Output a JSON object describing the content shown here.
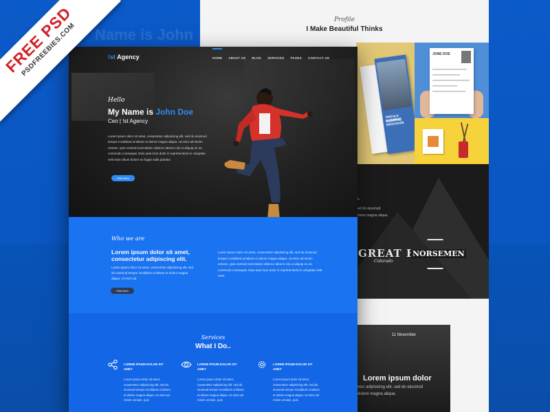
{
  "badge": {
    "main": "FREE PSD",
    "sub": "PSDFREEBIES.COM"
  },
  "background_ghost": "Name is John",
  "back_page": {
    "profile_script": "Profile",
    "profile_title": "I Make Beautiful Thinks",
    "brochure_line1": "TRIFOLD BUSINESS",
    "brochure_line2": "CREATIVE BROCHURE",
    "resume_name": "JONE DOE",
    "dark_text_a": "o..",
    "dark_text_b": "sed do eiusmod",
    "dark_text_c": "dolore magna aliqua.",
    "logo_great": "GREAT  FALLS",
    "logo_colorado": "Colorado",
    "logo_norsemen": "NORSEMEN",
    "news_date": "11 November",
    "news_title": "Lorem ipsum dolor",
    "news_text1": "etur adipisicing elit, sed do eiusmod",
    "news_text2": "dolore magna aliqua."
  },
  "front_page": {
    "brand_prefix": "!st",
    "brand_suffix": " Agency",
    "nav": [
      "HOME",
      "ABOUT US",
      "BLOG",
      "SERVICES",
      "PAGES",
      "CONTACT US"
    ],
    "hero": {
      "hello": "Hello",
      "title_prefix": "My Name is ",
      "title_name": "John Doe",
      "subtitle": "Ceo |  !st Agency",
      "paragraph": "Lorem ipsum dolor sit amet, consectetur adipisicing elit, sed do eiusmod tempor incididunt ut labore et dolore magna aliqua. Ut enim ad minim veniam, quis nostrud exercitation ullamco laboris nisi ut aliquip ex ea commodo consequat. Duis aute irure dolor in reprehenderit in voluptate velit esse cillum dolore eu fugiat nulla pariatur.",
      "button": "Click here"
    },
    "who": {
      "script": "Who we are",
      "heading_line1": "Lorem ipsum dolor sit amet,",
      "heading_line2": "consectetur adipiscing elit.",
      "left_paragraph": "Lorem ipsum dolor sit amet, consectetur adipisicing elit, sed do eiusmod tempor incididunt ut labore et dolore magna aliqua. Ut enim ad",
      "right_paragraph": "Lorem ipsum dolor sit amet, consectetur adipisicing elit, sed do eiusmod tempor incididunt ut labore et dolore magna aliqua. Ut enim ad minim veniam, quis nostrud exercitation ullamco laboris nisi ut aliquip ex ea commodo consequat. Duis aute irure dolor in reprehenderit in voluptate velit esse",
      "button": "Click here"
    },
    "services": {
      "script": "Services",
      "title": "What I Do..",
      "items": [
        {
          "icon": "share-icon",
          "head": "LOREM IPSUM DOLOR SIT AMET",
          "text": "Lorem ipsum dolor sit amet, consectetur adipisicing elit, sed do eiusmod tempor incididunt ut labore et dolore magna aliqua. Ut enim ad minim veniam, quis"
        },
        {
          "icon": "eye-icon",
          "head": "LOREM IPSUM DOLOR SIT AMET",
          "text": "Lorem ipsum dolor sit amet, consectetur adipisicing elit, sed do eiusmod tempor incididunt ut labore et dolore magna aliqua. Ut enim ad minim veniam, quis"
        },
        {
          "icon": "gear-icon",
          "head": "LOREM IPSUM DOLOR SIT AMET",
          "text": "Lorem ipsum dolor sit amet, consectetur adipisicing elit, sed do eiusmod tempor incididunt ut labore et dolore magna aliqua. Ut enim ad minim veniam, quis"
        }
      ]
    }
  },
  "colors": {
    "accent": "#2f8cf5",
    "who_band": "#1a73f0",
    "services_band": "#1366e6",
    "badge_red": "#d21f26"
  }
}
